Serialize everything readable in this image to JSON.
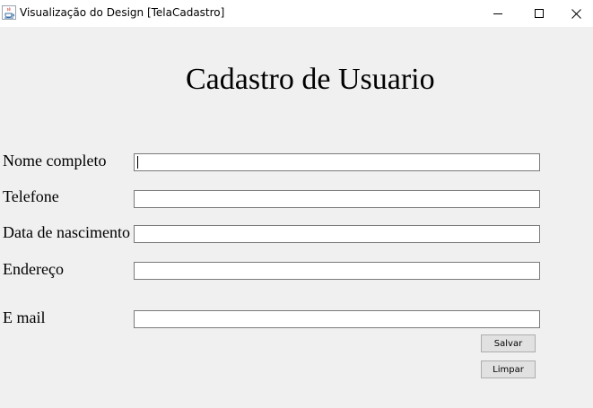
{
  "window": {
    "title": "Visualização do Design [TelaCadastro]",
    "icon": "java-coffee-icon",
    "controls": [
      "minimize-icon",
      "maximize-icon",
      "close-icon"
    ]
  },
  "form": {
    "heading": "Cadastro de Usuario",
    "fields": [
      {
        "label": "Nome completo",
        "value": "",
        "focused": true
      },
      {
        "label": "Telefone",
        "value": ""
      },
      {
        "label": "Data de nascimento",
        "value": ""
      },
      {
        "label": "Endereço",
        "value": ""
      },
      {
        "label": "E mail",
        "value": ""
      }
    ],
    "buttons": {
      "save": "Salvar",
      "clear": "Limpar"
    }
  },
  "colors": {
    "background": "#f0f0f0",
    "titlebar": "#ffffff",
    "field_border": "#7a7a7a",
    "button_face": "#e1e1e1"
  }
}
